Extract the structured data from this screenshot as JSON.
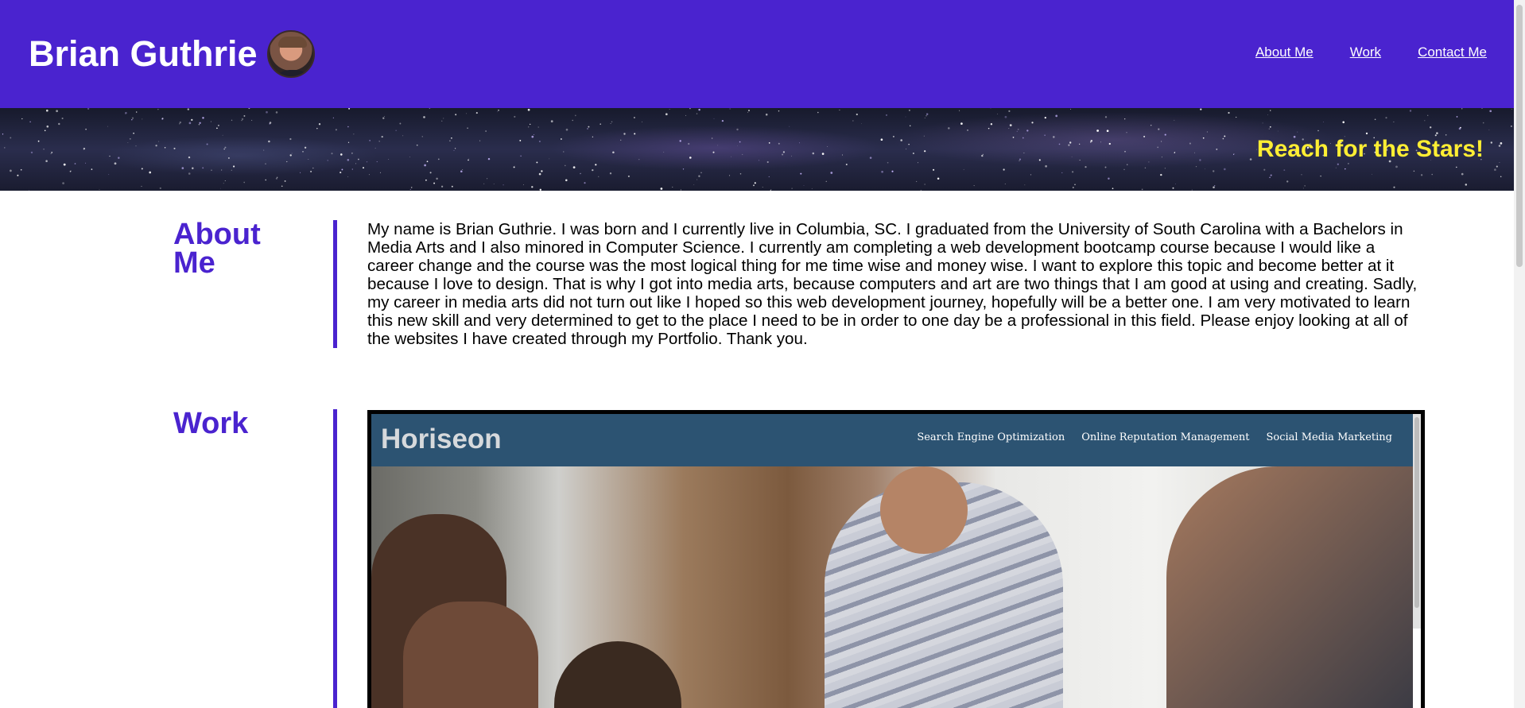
{
  "header": {
    "title": "Brian Guthrie",
    "avatar": "profile-photo",
    "nav": [
      "About Me",
      "Work",
      "Contact Me"
    ],
    "bg_color": "#4a23cf"
  },
  "banner": {
    "text": "Reach for the Stars!",
    "text_color": "#ffee33"
  },
  "about": {
    "heading": "About Me",
    "text": "My name is Brian Guthrie. I was born and I currently live in Columbia, SC. I graduated from the University of South Carolina with a Bachelors in Media Arts and I also minored in Computer Science. I currently am completing a web development bootcamp course because I would like a career change and the course was the most logical thing for me time wise and money wise. I want to explore this topic and become better at it because I love to design. That is why I got into media arts, because computers and art are two things that I am good at using and creating. Sadly, my career in media arts did not turn out like I hoped so this web development journey, hopefully will be a better one. I am very motivated to learn this new skill and very determined to get to the place I need to be in order to one day be a professional in this field. Please enjoy looking at all of the websites I have created through my Portfolio. Thank you."
  },
  "work": {
    "heading": "Work",
    "project": {
      "logo": "Horiseon",
      "nav": [
        "Search Engine Optimization",
        "Online Reputation Management",
        "Social Media Marketing"
      ],
      "header_color": "#2c5372"
    }
  }
}
